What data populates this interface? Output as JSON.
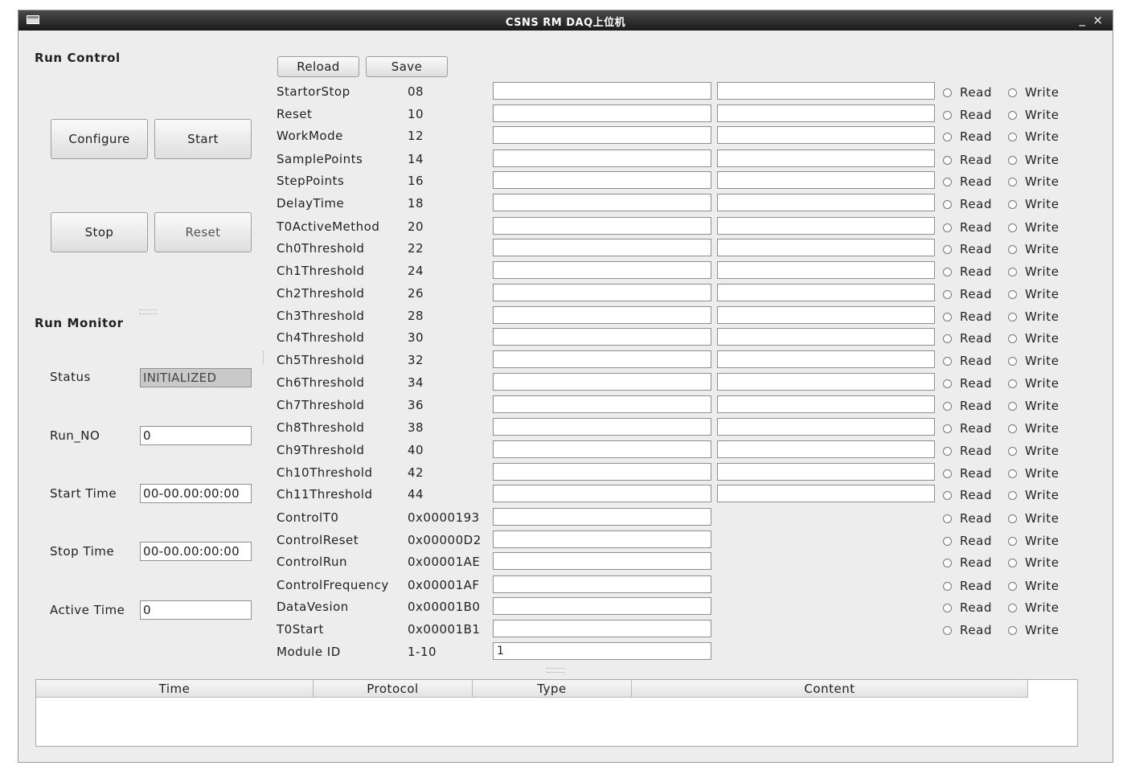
{
  "window": {
    "title": "CSNS RM DAQ上位机",
    "minimize": "_",
    "close": "×"
  },
  "run_control": {
    "title": "Run Control",
    "configure": "Configure",
    "start": "Start",
    "stop": "Stop",
    "reset": "Reset"
  },
  "run_monitor": {
    "title": "Run Monitor",
    "status_label": "Status",
    "status_value": "INITIALIZED",
    "run_no_label": "Run_NO",
    "run_no_value": "0",
    "start_time_label": "Start Time",
    "start_time_value": "00-00.00:00:00",
    "stop_time_label": "Stop Time",
    "stop_time_value": "00-00.00:00:00",
    "active_time_label": "Active Time",
    "active_time_value": "0"
  },
  "config": {
    "reload": "Reload",
    "save": "Save",
    "read_label": "Read",
    "write_label": "Write",
    "registers": [
      {
        "name": "StartorStop",
        "addr": "08"
      },
      {
        "name": "Reset",
        "addr": "10"
      },
      {
        "name": "WorkMode",
        "addr": "12"
      },
      {
        "name": "SamplePoints",
        "addr": "14"
      },
      {
        "name": "StepPoints",
        "addr": "16"
      },
      {
        "name": "DelayTime",
        "addr": "18"
      },
      {
        "name": "T0ActiveMethod",
        "addr": "20"
      },
      {
        "name": "Ch0Threshold",
        "addr": "22"
      },
      {
        "name": "Ch1Threshold",
        "addr": "24"
      },
      {
        "name": "Ch2Threshold",
        "addr": "26"
      },
      {
        "name": "Ch3Threshold",
        "addr": "28"
      },
      {
        "name": "Ch4Threshold",
        "addr": "30"
      },
      {
        "name": "Ch5Threshold",
        "addr": "32"
      },
      {
        "name": "Ch6Threshold",
        "addr": "34"
      },
      {
        "name": "Ch7Threshold",
        "addr": "36"
      },
      {
        "name": "Ch8Threshold",
        "addr": "38"
      },
      {
        "name": "Ch9Threshold",
        "addr": "40"
      },
      {
        "name": "Ch10Threshold",
        "addr": "42"
      },
      {
        "name": "Ch11Threshold",
        "addr": "44"
      },
      {
        "name": "ControlT0",
        "addr": "0x0000193"
      },
      {
        "name": "ControlReset",
        "addr": "0x00000D2"
      },
      {
        "name": "ControlRun",
        "addr": "0x00001AE"
      },
      {
        "name": "ControlFrequency",
        "addr": "0x00001AF"
      },
      {
        "name": "DataVesion",
        "addr": "0x00001B0"
      },
      {
        "name": "T0Start",
        "addr": "0x00001B1"
      }
    ],
    "module_id": {
      "name": "Module ID",
      "addr": "1-10",
      "value": "1"
    }
  },
  "log_table": {
    "columns": [
      "Time",
      "Protocol",
      "Type",
      "Content"
    ]
  }
}
